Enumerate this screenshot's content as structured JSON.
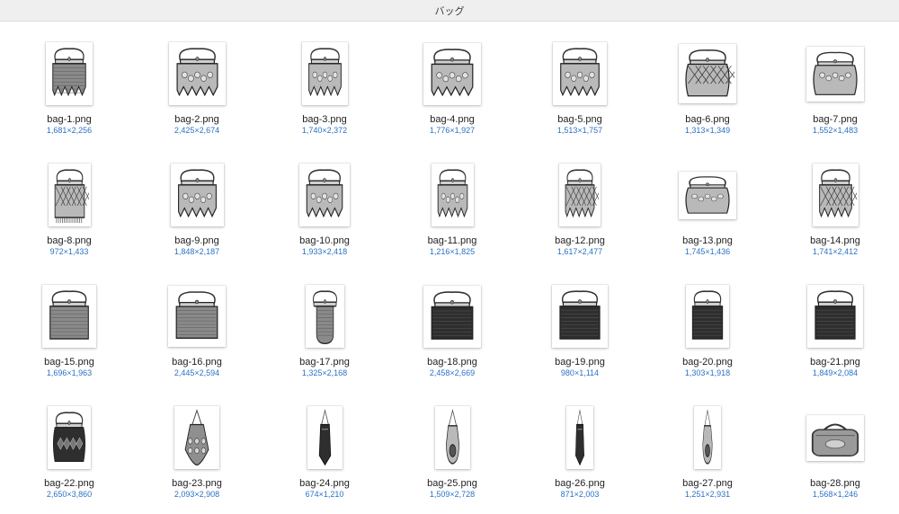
{
  "window": {
    "title": "バッグ"
  },
  "files": [
    {
      "name": "bag-1.png",
      "dims": "1,681×2,256",
      "aspect": 0.745,
      "style": "mesh-vfringe"
    },
    {
      "name": "bag-2.png",
      "dims": "2,425×2,674",
      "aspect": 0.907,
      "style": "floral-vfringe"
    },
    {
      "name": "bag-3.png",
      "dims": "1,740×2,372",
      "aspect": 0.734,
      "style": "floral-vfringe"
    },
    {
      "name": "bag-4.png",
      "dims": "1,776×1,927",
      "aspect": 0.922,
      "style": "floral-vfringe"
    },
    {
      "name": "bag-5.png",
      "dims": "1,513×1,757",
      "aspect": 0.861,
      "style": "floral-vfringe"
    },
    {
      "name": "bag-6.png",
      "dims": "1,313×1,349",
      "aspect": 0.973,
      "style": "diamond"
    },
    {
      "name": "bag-7.png",
      "dims": "1,552×1,483",
      "aspect": 1.047,
      "style": "floral-round"
    },
    {
      "name": "bag-8.png",
      "dims": "972×1,433",
      "aspect": 0.678,
      "style": "lattice-fringe"
    },
    {
      "name": "bag-9.png",
      "dims": "1,848×2,187",
      "aspect": 0.845,
      "style": "floral-vfringe"
    },
    {
      "name": "bag-10.png",
      "dims": "1,933×2,418",
      "aspect": 0.799,
      "style": "floral-vfringe"
    },
    {
      "name": "bag-11.png",
      "dims": "1,216×1,825",
      "aspect": 0.666,
      "style": "floral-vfringe"
    },
    {
      "name": "bag-12.png",
      "dims": "1,617×2,477",
      "aspect": 0.653,
      "style": "lattice-vfringe"
    },
    {
      "name": "bag-13.png",
      "dims": "1,745×1,436",
      "aspect": 1.215,
      "style": "floral-round"
    },
    {
      "name": "bag-14.png",
      "dims": "1,741×2,412",
      "aspect": 0.722,
      "style": "lattice-vfringe"
    },
    {
      "name": "bag-15.png",
      "dims": "1,696×1,963",
      "aspect": 0.864,
      "style": "mesh"
    },
    {
      "name": "bag-16.png",
      "dims": "2,445×2,594",
      "aspect": 0.943,
      "style": "mesh"
    },
    {
      "name": "bag-17.png",
      "dims": "1,325×2,168",
      "aspect": 0.611,
      "style": "mesh-oval"
    },
    {
      "name": "bag-18.png",
      "dims": "2,458×2,669",
      "aspect": 0.921,
      "style": "mesh-dark"
    },
    {
      "name": "bag-19.png",
      "dims": "980×1,114",
      "aspect": 0.88,
      "style": "mesh-dark"
    },
    {
      "name": "bag-20.png",
      "dims": "1,303×1,918",
      "aspect": 0.679,
      "style": "mesh-dark"
    },
    {
      "name": "bag-21.png",
      "dims": "1,849×2,084",
      "aspect": 0.887,
      "style": "mesh-dark"
    },
    {
      "name": "bag-22.png",
      "dims": "2,650×3,860",
      "aspect": 0.687,
      "style": "beaded-dark"
    },
    {
      "name": "bag-23.png",
      "dims": "2,093×2,908",
      "aspect": 0.72,
      "style": "pouch-floral"
    },
    {
      "name": "bag-24.png",
      "dims": "674×1,210",
      "aspect": 0.557,
      "style": "pouch-dark"
    },
    {
      "name": "bag-25.png",
      "dims": "1,509×2,728",
      "aspect": 0.553,
      "style": "pouch-round"
    },
    {
      "name": "bag-26.png",
      "dims": "871×2,003",
      "aspect": 0.435,
      "style": "pouch-dark"
    },
    {
      "name": "bag-27.png",
      "dims": "1,251×2,931",
      "aspect": 0.427,
      "style": "pouch-round"
    },
    {
      "name": "bag-28.png",
      "dims": "1,568×1,246",
      "aspect": 1.258,
      "style": "satchel"
    }
  ]
}
